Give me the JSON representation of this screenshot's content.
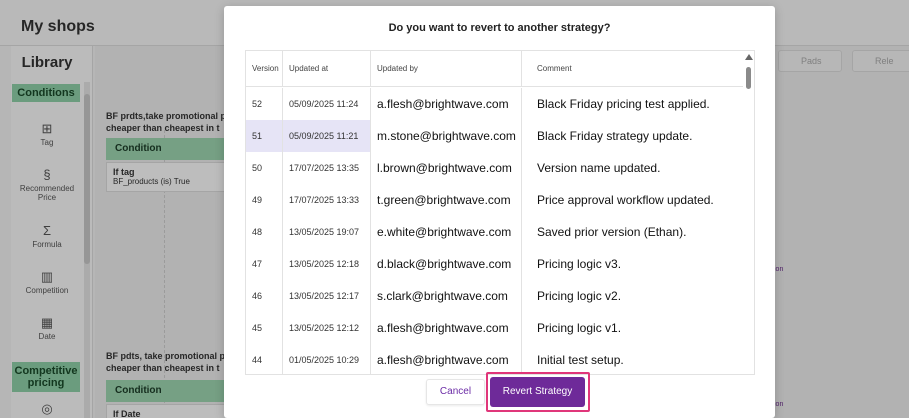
{
  "background": {
    "page_title": "My shops",
    "library": {
      "title": "Library",
      "sections": [
        "Conditions",
        "Competitive pricing"
      ],
      "items": [
        {
          "label": "Tag",
          "icon": "tag-icon"
        },
        {
          "label": "Recommended Price",
          "icon": "recommended-price-icon"
        },
        {
          "label": "Formula",
          "icon": "sigma-icon"
        },
        {
          "label": "Competition",
          "icon": "bar-chart-icon"
        },
        {
          "label": "Date",
          "icon": "calendar-icon"
        }
      ]
    },
    "canvas": {
      "rule1_line1": "BF prdts,take promotional p",
      "rule1_line2": "cheaper than cheapest in t",
      "condition_label": "Condition",
      "if_tag": "If tag",
      "if_tag_detail": "BF_products (is) True",
      "rule2_line1": "BF pdts, take promotional p",
      "rule2_line2": "cheaper than cheapest in t",
      "condition2_label": "Condition",
      "if_date": "If Date",
      "ghost_button_1": "Pads",
      "ghost_button_2": "Rele",
      "right_tag_1": "ion",
      "right_tag_2": "ion"
    }
  },
  "modal": {
    "title": "Do you want to revert to another strategy?",
    "columns": [
      "Version",
      "Updated at",
      "Updated by",
      "Comment"
    ],
    "rows": [
      {
        "version": "52",
        "updated_at": "05/09/2025 11:24",
        "updated_by": "a.flesh@brightwave.com",
        "comment": "Black Friday pricing test applied."
      },
      {
        "version": "51",
        "updated_at": "05/09/2025 11:21",
        "updated_by": "m.stone@brightwave.com",
        "comment": "Black Friday strategy update."
      },
      {
        "version": "50",
        "updated_at": "17/07/2025 13:35",
        "updated_by": "l.brown@brightwave.com",
        "comment": "Version name updated."
      },
      {
        "version": "49",
        "updated_at": "17/07/2025 13:33",
        "updated_by": "t.green@brightwave.com",
        "comment": "Price approval workflow updated."
      },
      {
        "version": "48",
        "updated_at": "13/05/2025 19:07",
        "updated_by": "e.white@brightwave.com",
        "comment": "Saved prior version (Ethan)."
      },
      {
        "version": "47",
        "updated_at": "13/05/2025 12:18",
        "updated_by": "d.black@brightwave.com",
        "comment": "Pricing logic v3."
      },
      {
        "version": "46",
        "updated_at": "13/05/2025 12:17",
        "updated_by": "s.clark@brightwave.com",
        "comment": "Pricing logic v2."
      },
      {
        "version": "45",
        "updated_at": "13/05/2025 12:12",
        "updated_by": "a.flesh@brightwave.com",
        "comment": "Pricing logic v1."
      },
      {
        "version": "44",
        "updated_at": "01/05/2025 10:29",
        "updated_by": "a.flesh@brightwave.com",
        "comment": "Initial test setup."
      }
    ],
    "selected_version": "51",
    "cancel_label": "Cancel",
    "revert_label": "Revert Strategy"
  },
  "colors": {
    "accent_purple": "#6e2a99",
    "highlight_pink": "#e0367a",
    "selected_row": "#e6e4f6",
    "library_section": "#8fd1a8"
  }
}
